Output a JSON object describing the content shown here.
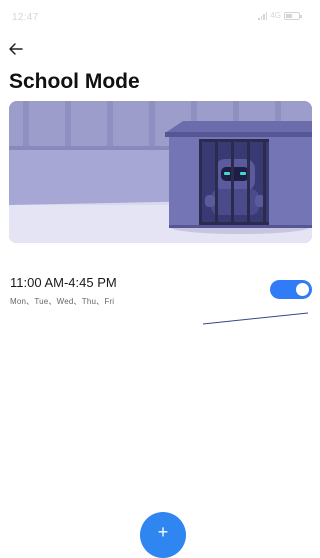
{
  "status_bar": {
    "time": "12:47",
    "network": "4G",
    "battery_level": 0.5
  },
  "header": {
    "title": "School Mode"
  },
  "schedule": {
    "time_range": "11:00 AM-4:45 PM",
    "days": "Mon、Tue、Wed、Thu、Fri",
    "enabled": true
  },
  "fab": {
    "label": "+"
  },
  "icons": {
    "back": "back-arrow-icon",
    "signal": "signal-icon",
    "battery": "battery-icon"
  },
  "colors": {
    "accent": "#2f7cf6",
    "hero_background": "#a6a7d4",
    "hero_floor": "#e4e4f4",
    "cage": "#5a5b99",
    "robot": "#4b4a8a"
  }
}
